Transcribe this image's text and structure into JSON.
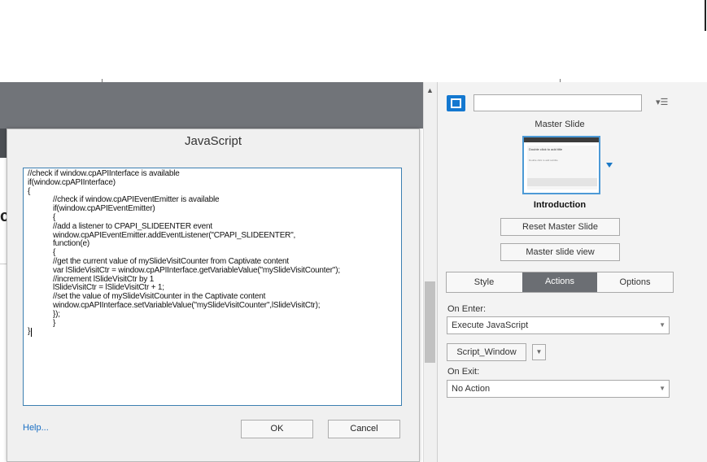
{
  "dialog": {
    "title": "JavaScript",
    "code_lines": [
      "//check if window.cpAPIInterface is available",
      "if(window.cpAPIInterface)",
      "{",
      "            //check if window.cpAPIEventEmitter is available",
      "            if(window.cpAPIEventEmitter)",
      "            {",
      "            //add a listener to CPAPI_SLIDEENTER event",
      "            window.cpAPIEventEmitter.addEventListener(\"CPAPI_SLIDEENTER\",",
      "            function(e)",
      "            {",
      "            //get the current value of mySlideVisitCounter from Captivate content",
      "            var lSlideVisitCtr = window.cpAPIInterface.getVariableValue(\"mySlideVisitCounter\");",
      "            //increment lSlideVisitCtr by 1",
      "            lSlideVisitCtr = lSlideVisitCtr + 1;",
      "            //set the value of mySlideVisitCounter in the Captivate content",
      "            window.cpAPIInterface.setVariableValue(\"mySlideVisitCounter\",lSlideVisitCtr);",
      "            });",
      "            }",
      "}"
    ],
    "help_label": "Help...",
    "ok_label": "OK",
    "cancel_label": "Cancel"
  },
  "panel": {
    "name_value": "",
    "master_label": "Master Slide",
    "thumbnail": {
      "title": "Double click to add title",
      "subtitle": "Double click to add subtitle"
    },
    "slide_title": "Introduction",
    "reset_label": "Reset Master Slide",
    "master_view_label": "Master slide view",
    "tabs": [
      {
        "label": "Style"
      },
      {
        "label": "Actions"
      },
      {
        "label": "Options"
      }
    ],
    "active_tab": "Actions",
    "on_enter_label": "On Enter:",
    "on_enter_value": "Execute JavaScript",
    "script_window_label": "Script_Window",
    "on_exit_label": "On Exit:",
    "on_exit_value": "No Action"
  },
  "icons": {
    "panel_menu": "panel-menu-icon",
    "slide": "slide-icon",
    "dropdown": "chevron-down-icon"
  },
  "colors": {
    "accent": "#1478d0",
    "active_tab": "#6b6e73",
    "stage_bar": "#717479",
    "code_border": "#3c7fb1",
    "link": "#1a6fc4"
  }
}
